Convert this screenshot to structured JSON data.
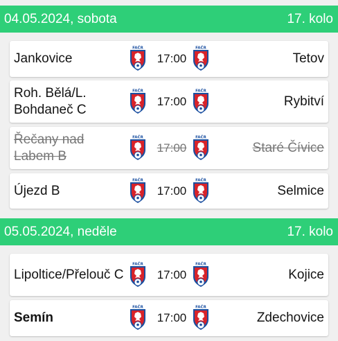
{
  "days": [
    {
      "date": "04.05.2024, sobota",
      "round": "17. kolo",
      "matches": [
        {
          "home": "Jankovice",
          "time": "17:00",
          "away": "Tetov",
          "status": "normal"
        },
        {
          "home": "Roh. Bělá/L. Bohdaneč C",
          "time": "17:00",
          "away": "Rybitví",
          "status": "normal"
        },
        {
          "home": "Řečany nad Labem B",
          "time": "17:00",
          "away": "Staré Čívice",
          "status": "cancelled"
        },
        {
          "home": "Újezd B",
          "time": "17:00",
          "away": "Selmice",
          "status": "normal"
        }
      ]
    },
    {
      "date": "05.05.2024, neděle",
      "round": "17. kolo",
      "matches": [
        {
          "home": "Lipoltice/Přelouč C",
          "time": "17:00",
          "away": "Kojice",
          "status": "normal"
        },
        {
          "home": "Semín",
          "time": "17:00",
          "away": "Zdechovice",
          "status": "normal",
          "home_bold": true
        }
      ]
    }
  ],
  "crest": {
    "icon": "facr-crest-icon",
    "text": "FAČR",
    "colors": {
      "shield": "#1a4fa0",
      "red": "#d8232a",
      "white": "#ffffff"
    }
  },
  "colors": {
    "header": "#2ecf78",
    "background": "#f0f0f0"
  }
}
